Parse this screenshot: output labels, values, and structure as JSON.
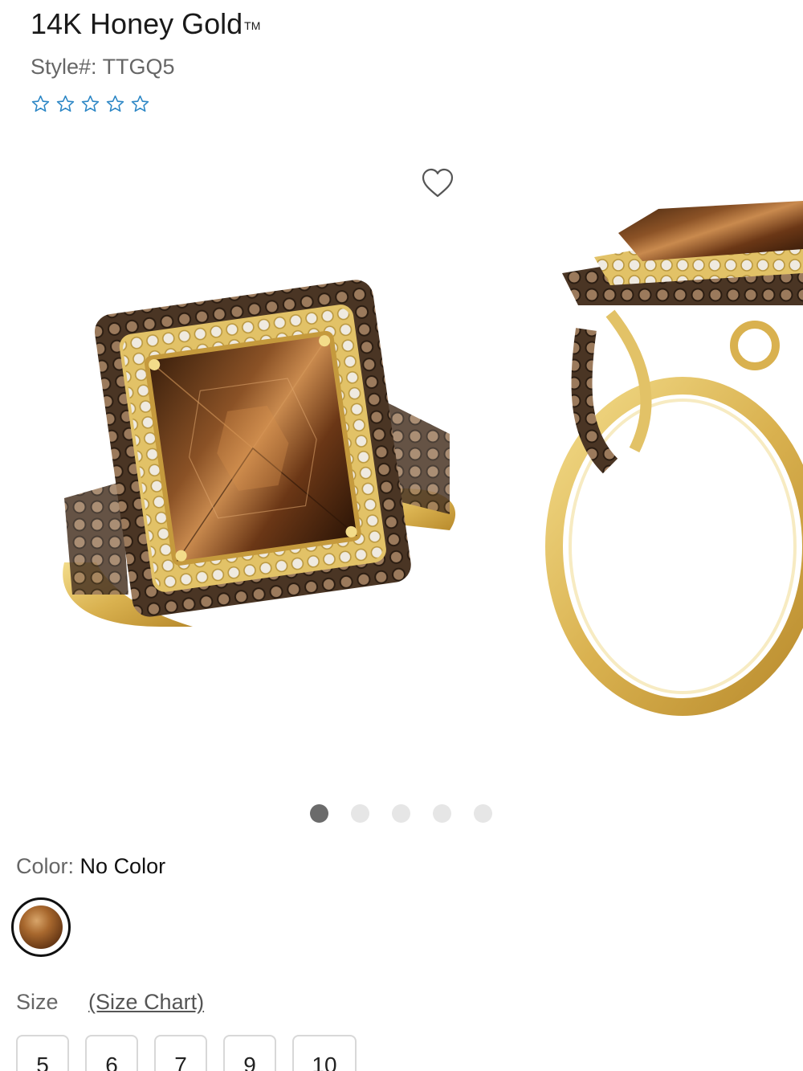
{
  "product": {
    "title": "14K Honey Gold",
    "trademark": "TM",
    "style_label": "Style#:",
    "style_value": "TTGQ5",
    "rating": {
      "max": 5,
      "filled": 0
    }
  },
  "gallery": {
    "image_count": 5,
    "active_index": 0,
    "favorite_icon": "heart-icon"
  },
  "color": {
    "label": "Color:",
    "value": "No Color"
  },
  "size": {
    "label": "Size",
    "chart_link": "(Size Chart)",
    "options": [
      "5",
      "6",
      "7",
      "9",
      "10"
    ]
  },
  "colors": {
    "star_outline": "#2b86c5",
    "gold": "#e2c267",
    "stone": "#6a3a1a"
  }
}
